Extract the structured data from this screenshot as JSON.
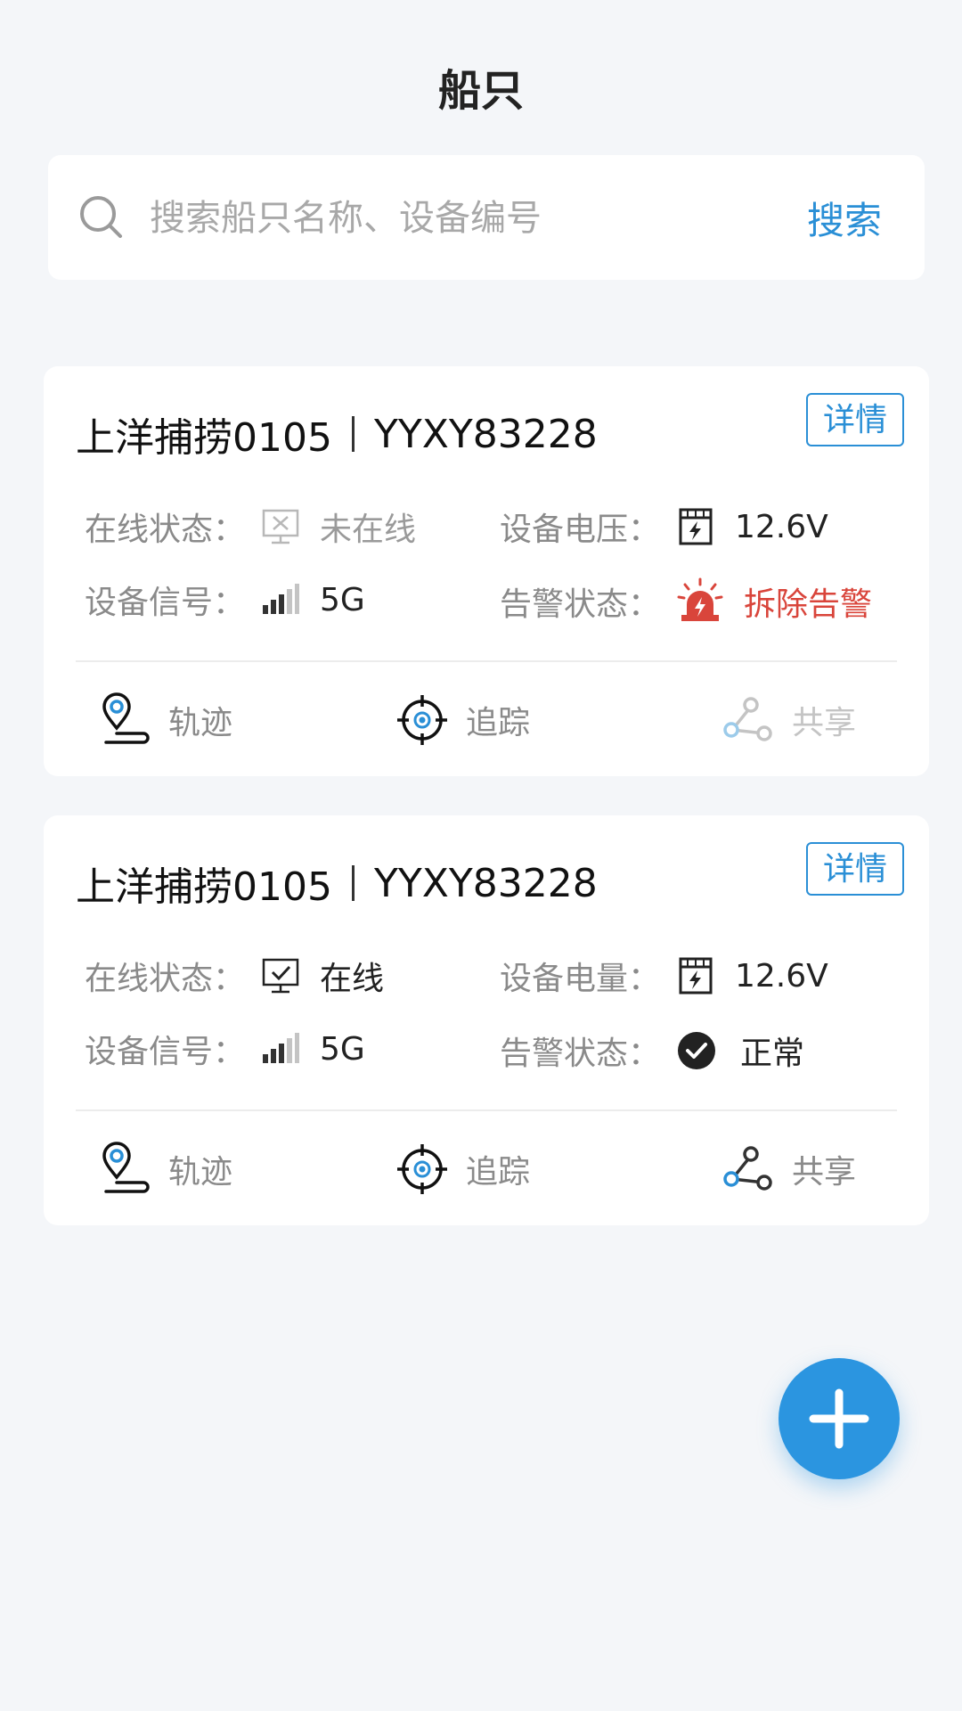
{
  "page": {
    "title": "船只"
  },
  "search": {
    "placeholder": "搜索船只名称、设备编号",
    "button_label": "搜索"
  },
  "colors": {
    "accent": "#2a8fd6",
    "alarm": "#d9453b",
    "muted": "#9a9a9a"
  },
  "cards": [
    {
      "name": "上洋捕捞0105",
      "device_id": "YYXY83228",
      "details_label": "详情",
      "online_label": "在线状态：",
      "online_value": "未在线",
      "online_icon": "monitor-offline-icon",
      "power_label": "设备电压：",
      "power_value": "12.6V",
      "signal_label": "设备信号：",
      "signal_value": "5G",
      "alarm_label": "告警状态：",
      "alarm_value": "拆除告警",
      "alarm_icon": "siren-icon",
      "actions": {
        "track": "轨迹",
        "follow": "追踪",
        "share": "共享"
      }
    },
    {
      "name": "上洋捕捞0105",
      "device_id": "YYXY83228",
      "details_label": "详情",
      "online_label": "在线状态：",
      "online_value": "在线",
      "online_icon": "monitor-online-icon",
      "power_label": "设备电量：",
      "power_value": "12.6V",
      "signal_label": "设备信号：",
      "signal_value": "5G",
      "alarm_label": "告警状态：",
      "alarm_value": "正常",
      "alarm_icon": "check-circle-icon",
      "actions": {
        "track": "轨迹",
        "follow": "追踪",
        "share": "共享"
      }
    }
  ]
}
